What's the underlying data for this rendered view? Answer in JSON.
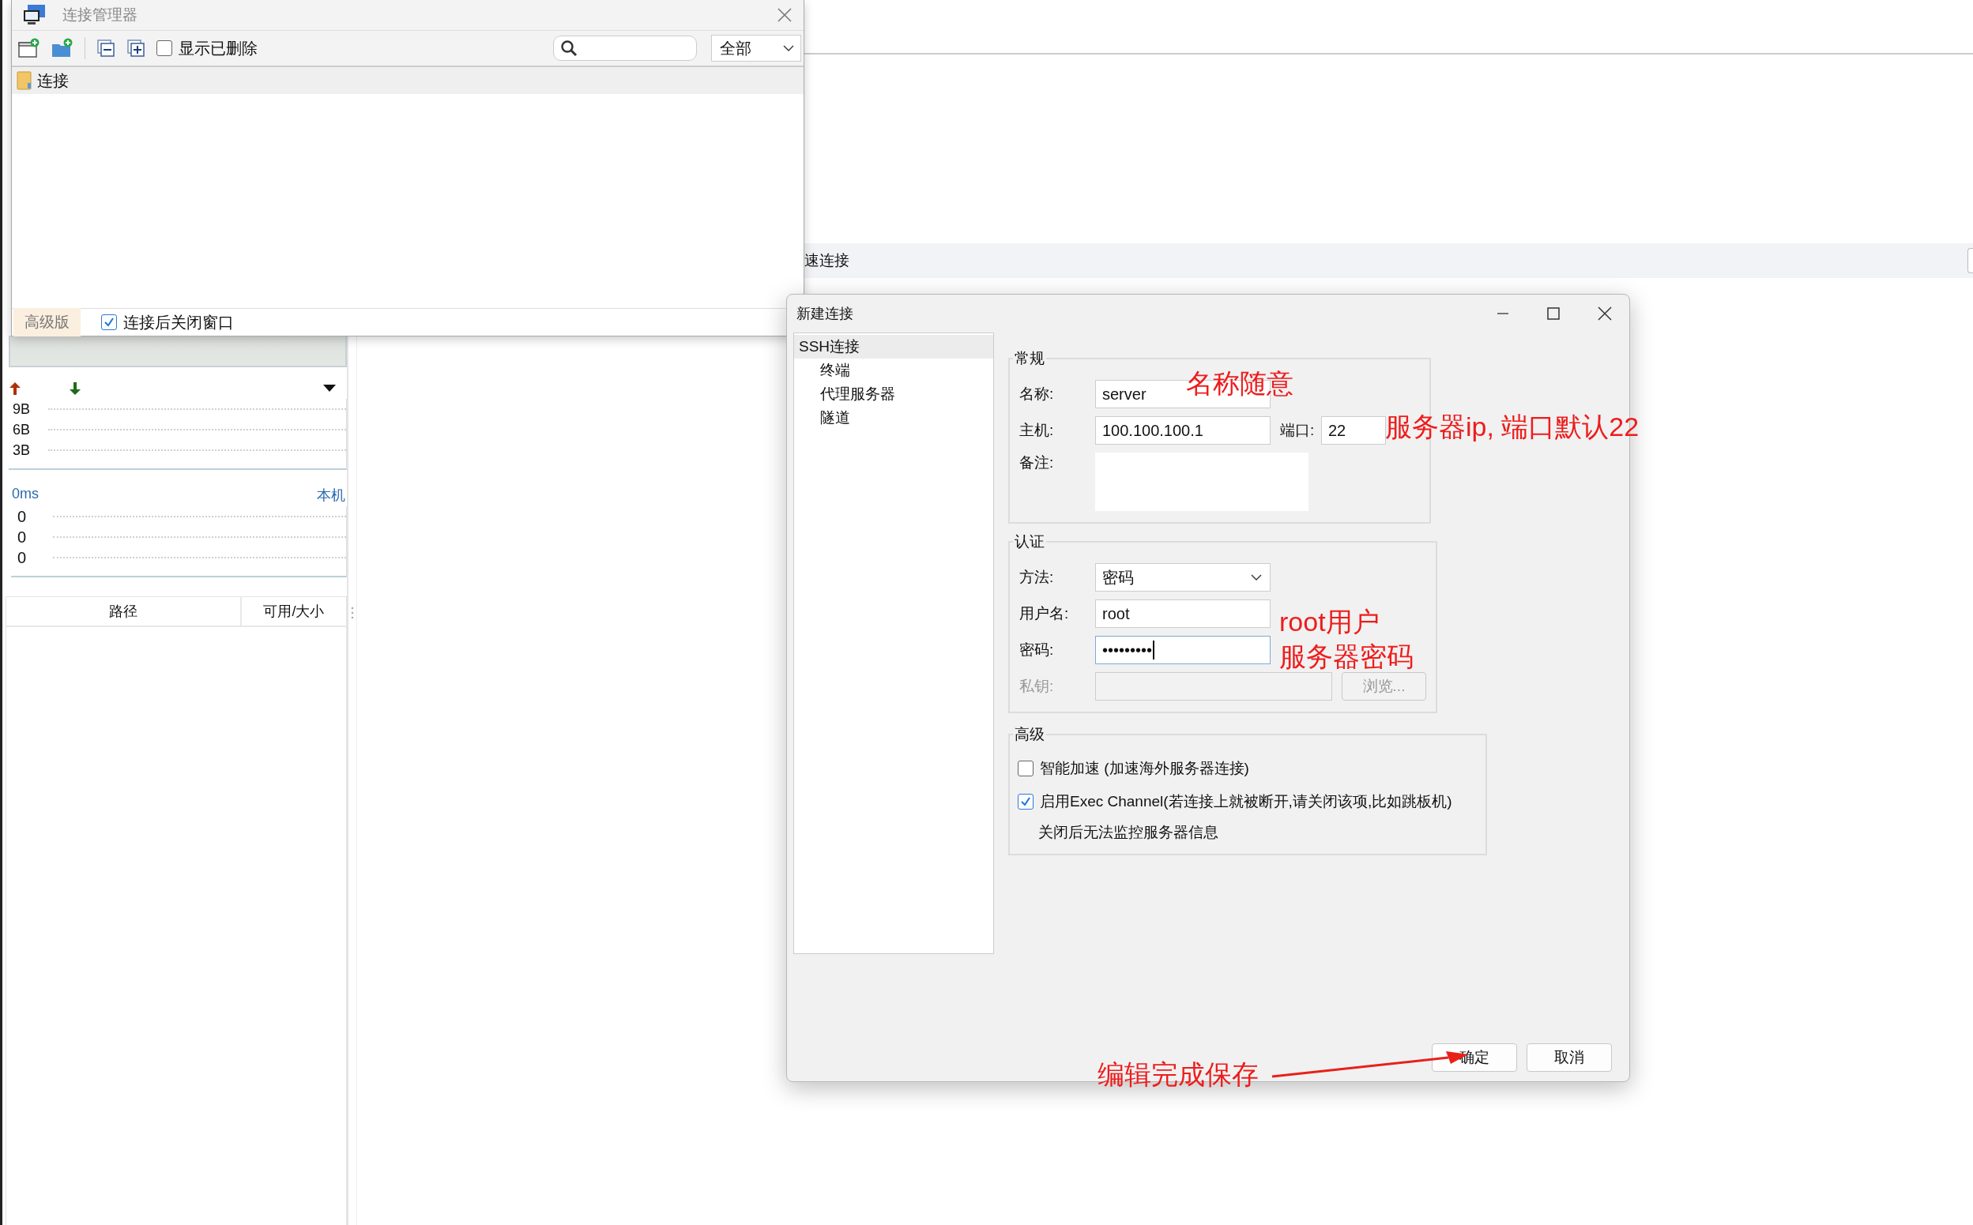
{
  "background_app": {
    "quick_connect": "速连接",
    "traffic": {
      "axis_labels": [
        "9B",
        "6B",
        "3B"
      ]
    },
    "latency": {
      "reading": "0ms",
      "host": "本机",
      "values": [
        "0",
        "0",
        "0"
      ]
    },
    "disk_table": {
      "columns": [
        "路径",
        "可用/大小"
      ]
    }
  },
  "connection_manager": {
    "title": "连接管理器",
    "show_deleted": {
      "label": "显示已删除",
      "checked": false
    },
    "filter": {
      "value": "全部"
    },
    "tree": [
      {
        "label": "连接",
        "selected": true
      }
    ],
    "edition_badge": "高级版",
    "close_after_connect": {
      "label": "连接后关闭窗口",
      "checked": true
    }
  },
  "new_connection_dialog": {
    "title": "新建连接",
    "nav": [
      {
        "label": "SSH连接",
        "selected": true,
        "children": [
          {
            "label": "终端",
            "selected": false
          },
          {
            "label": "代理服务器",
            "selected": false
          },
          {
            "label": "隧道",
            "selected": false
          }
        ]
      }
    ],
    "general": {
      "title": "常规",
      "name": {
        "label": "名称:",
        "value": "server"
      },
      "host": {
        "label": "主机:",
        "value": "100.100.100.1"
      },
      "port": {
        "label": "端口:",
        "value": "22"
      },
      "note": {
        "label": "备注:"
      }
    },
    "auth": {
      "title": "认证",
      "method": {
        "label": "方法:",
        "value": "密码"
      },
      "username": {
        "label": "用户名:",
        "value": "root"
      },
      "password": {
        "label": "密码:",
        "value": "•••••••••",
        "focused": true
      },
      "private_key": {
        "label": "私钥:",
        "disabled": true
      },
      "browse_button": {
        "label": "浏览...",
        "disabled": true
      }
    },
    "advanced": {
      "title": "高级",
      "options": [
        {
          "label": "智能加速 (加速海外服务器连接)",
          "checked": false
        },
        {
          "label": "启用Exec Channel(若连接上就被断开,请关闭该项,比如跳板机)",
          "checked": true
        }
      ],
      "note": "关闭后无法监控服务器信息"
    },
    "buttons": [
      {
        "label": "确定"
      },
      {
        "label": "取消"
      }
    ]
  },
  "annotations": [
    {
      "text": "名称随意"
    },
    {
      "text": "服务器ip, 端口默认22"
    },
    {
      "text": "root用户"
    },
    {
      "text": "服务器密码"
    },
    {
      "text": "编辑完成保存"
    }
  ]
}
